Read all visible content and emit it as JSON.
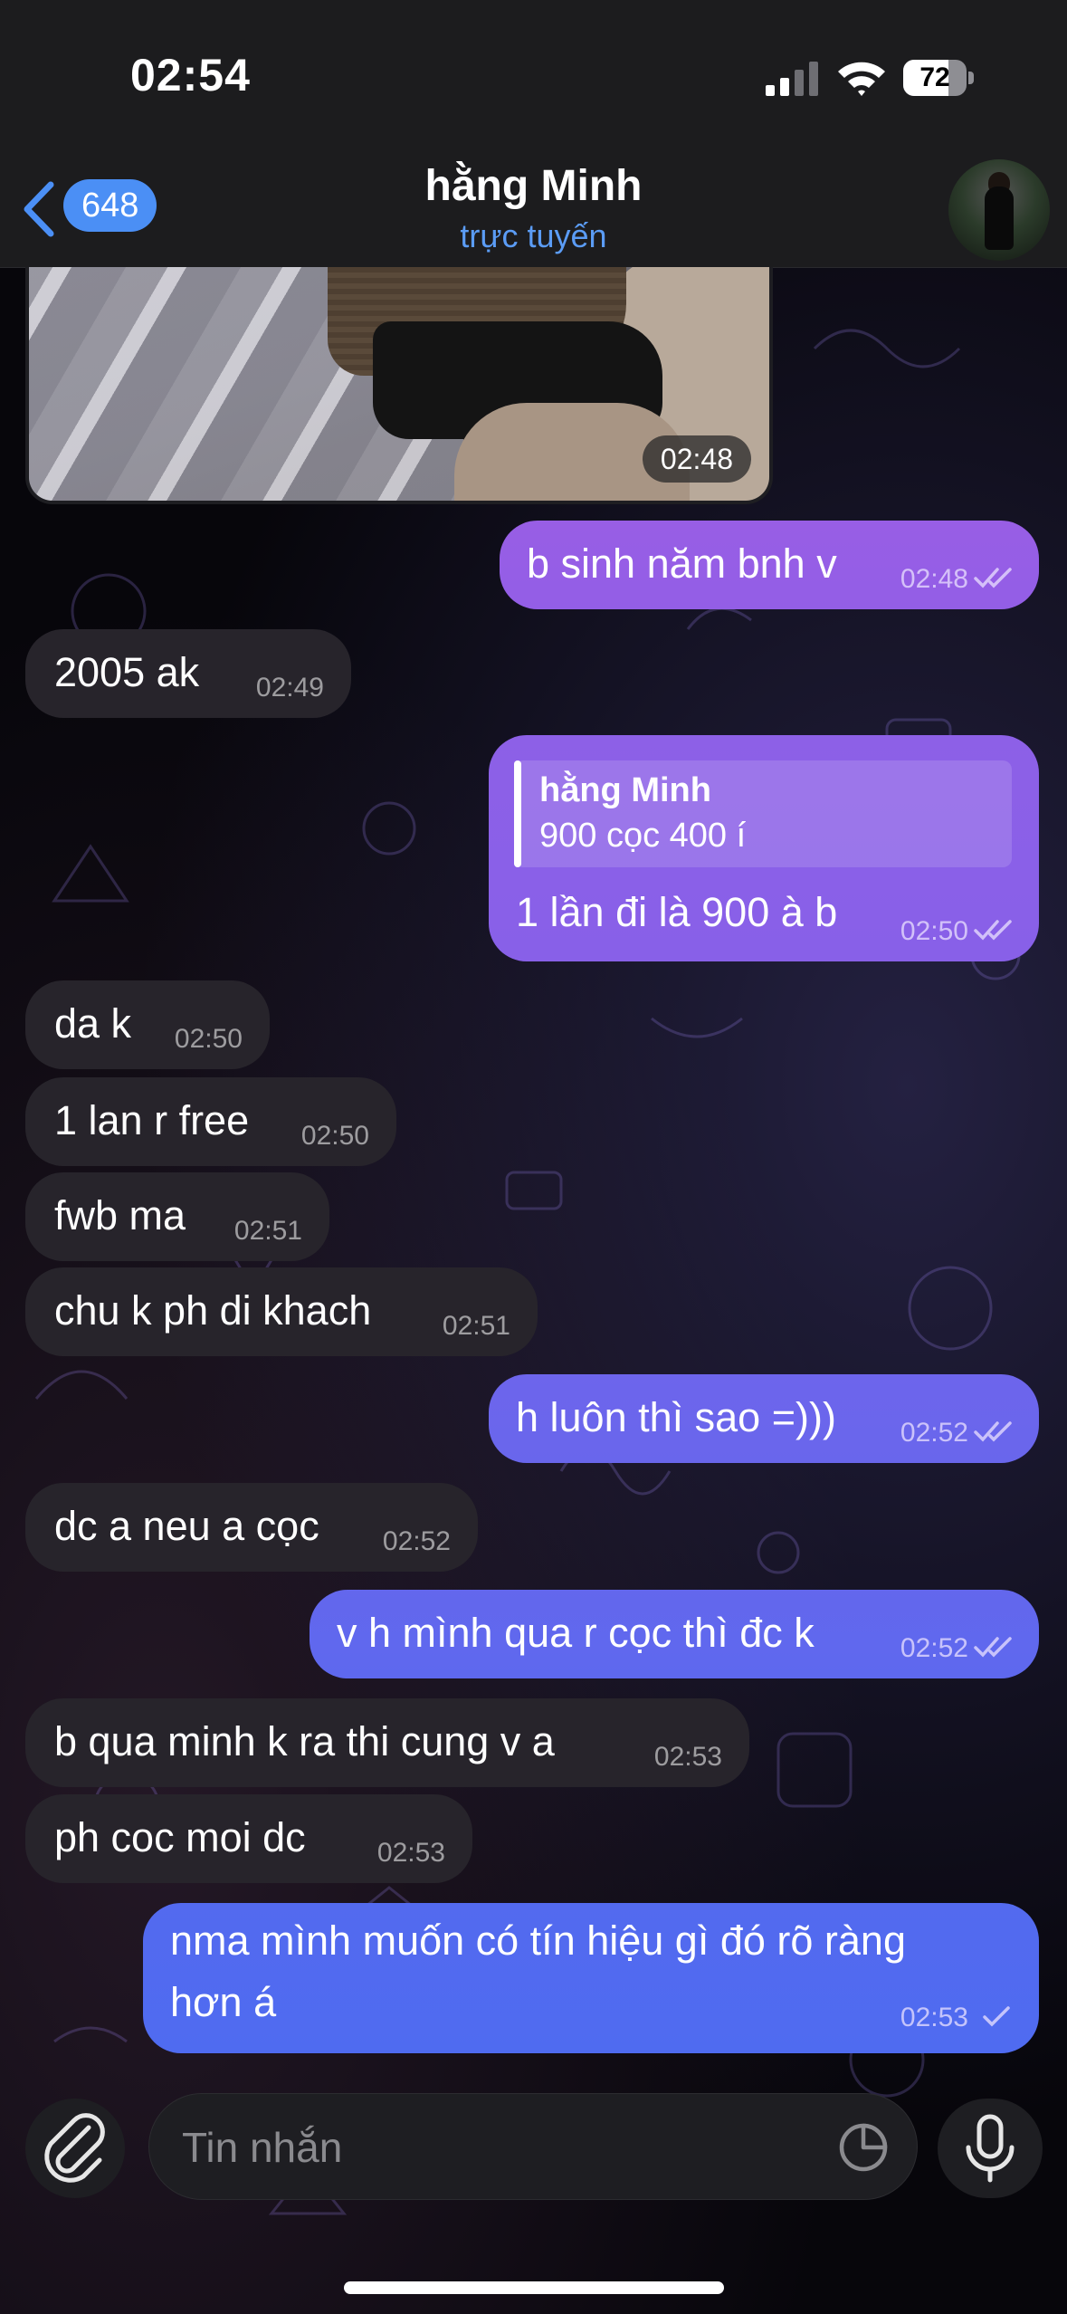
{
  "status_bar": {
    "time": "02:54",
    "battery": "72",
    "battery_level": 0.72
  },
  "header": {
    "back_count": "648",
    "contact_name": "hằng Minh",
    "contact_status": "trực tuyến"
  },
  "photo": {
    "time": "02:48"
  },
  "messages": [
    {
      "dir": "out",
      "text": "b sinh năm bnh v",
      "time": "02:48",
      "read": true
    },
    {
      "dir": "in",
      "text": "2005 ak",
      "time": "02:49"
    },
    {
      "dir": "out",
      "reply_name": "hằng Minh",
      "reply_text": "900 cọc 400 í",
      "text": "1 lần đi là 900 à b",
      "time": "02:50",
      "read": true
    },
    {
      "dir": "in",
      "text": "da k",
      "time": "02:50"
    },
    {
      "dir": "in",
      "text": "1 lan r free",
      "time": "02:50"
    },
    {
      "dir": "in",
      "text": "fwb ma",
      "time": "02:51"
    },
    {
      "dir": "in",
      "text": "chu k ph di khach",
      "time": "02:51"
    },
    {
      "dir": "out",
      "text": "h luôn thì sao =)))",
      "time": "02:52",
      "read": true
    },
    {
      "dir": "in",
      "text": "dc a neu a cọc",
      "time": "02:52"
    },
    {
      "dir": "out",
      "text": "v h mình qua r cọc thì đc k",
      "time": "02:52",
      "read": true
    },
    {
      "dir": "in",
      "text": "b qua minh k ra thi cung v a",
      "time": "02:53"
    },
    {
      "dir": "in",
      "text": "ph coc moi dc",
      "time": "02:53"
    },
    {
      "dir": "out",
      "text_line1": "nma mình muốn có tín hiệu gì đó rõ ràng",
      "text_line2": "hơn á",
      "time": "02:53",
      "read": false
    }
  ],
  "input": {
    "placeholder": "Tin nhắn"
  },
  "colors": {
    "bubble_out_top": "#9b5de5",
    "bubble_out_bottom": "#4f6bf0",
    "bubble_in": "#27242b",
    "accent": "#4b8ff5"
  }
}
